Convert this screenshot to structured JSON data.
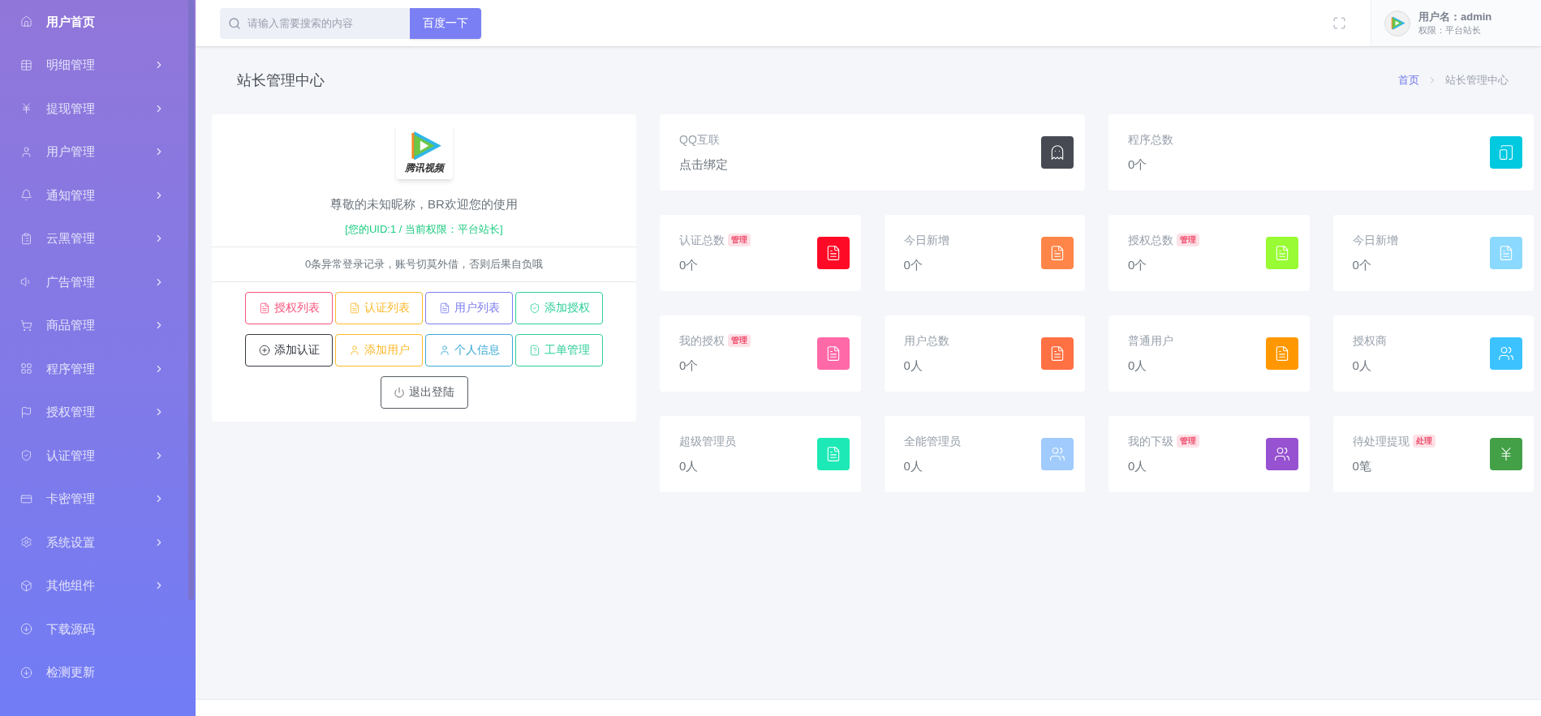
{
  "sidebar": {
    "items": [
      {
        "label": "用户首页",
        "expandable": false,
        "selected": true
      },
      {
        "label": "明细管理",
        "expandable": true,
        "selected": false
      },
      {
        "label": "提现管理",
        "expandable": true,
        "selected": false
      },
      {
        "label": "用户管理",
        "expandable": true,
        "selected": false
      },
      {
        "label": "通知管理",
        "expandable": true,
        "selected": false
      },
      {
        "label": "云黑管理",
        "expandable": true,
        "selected": false
      },
      {
        "label": "广告管理",
        "expandable": true,
        "selected": false
      },
      {
        "label": "商品管理",
        "expandable": true,
        "selected": false
      },
      {
        "label": "程序管理",
        "expandable": true,
        "selected": false
      },
      {
        "label": "授权管理",
        "expandable": true,
        "selected": false
      },
      {
        "label": "认证管理",
        "expandable": true,
        "selected": false
      },
      {
        "label": "卡密管理",
        "expandable": true,
        "selected": false
      },
      {
        "label": "系统设置",
        "expandable": true,
        "selected": false
      },
      {
        "label": "其他组件",
        "expandable": true,
        "selected": false
      },
      {
        "label": "下载源码",
        "expandable": false,
        "selected": false
      },
      {
        "label": "检测更新",
        "expandable": false,
        "selected": false
      }
    ]
  },
  "topbar": {
    "search": {
      "placeholder": "请输入需要搜索的内容"
    },
    "search_button": "百度一下",
    "user": {
      "name": "用户名：admin",
      "role": "权限：平台站长"
    }
  },
  "page": {
    "title": "站长管理中心",
    "breadcrumb": [
      "首页",
      "站长管理中心"
    ]
  },
  "profile": {
    "logo_text": "腾讯视频",
    "greeting": "尊敬的未知昵称，BR欢迎您的使用",
    "uid_line": "[您的UID:1 / 当前权限：平台站长]",
    "notice": "0条异常登录记录，账号切莫外借，否则后果自负哦",
    "buttons": [
      {
        "label": "授权列表",
        "color": "#f9547a"
      },
      {
        "label": "认证列表",
        "color": "#fcb92c"
      },
      {
        "label": "用户列表",
        "color": "#7c7cf0"
      },
      {
        "label": "添加授权",
        "color": "#2ecf98"
      },
      {
        "label": "添加认证",
        "color": "#343a40"
      },
      {
        "label": "添加用户",
        "color": "#fcb92c"
      },
      {
        "label": "个人信息",
        "color": "#3ba9d6"
      },
      {
        "label": "工单管理",
        "color": "#2ecf98"
      },
      {
        "label": "退出登陆",
        "color": "#555b61"
      }
    ]
  },
  "stats": [
    {
      "label": "QQ互联",
      "value": "点击绑定",
      "color": "#474a52"
    },
    {
      "label": "程序总数",
      "value": "0个",
      "color": "#00c9e0"
    },
    {
      "label": "认证总数",
      "badge": "管理",
      "value": "0个",
      "color": "#ff0a26"
    },
    {
      "label": "今日新增",
      "value": "0个",
      "color": "#ff8548"
    },
    {
      "label": "授权总数",
      "badge": "管理",
      "value": "0个",
      "color": "#98fb33"
    },
    {
      "label": "今日新增",
      "value": "0个",
      "color": "#8bd9fe"
    },
    {
      "label": "我的授权",
      "badge": "管理",
      "value": "0个",
      "color": "#ff69a8"
    },
    {
      "label": "用户总数",
      "value": "0人",
      "color": "#ff7043"
    },
    {
      "label": "普通用户",
      "value": "0人",
      "color": "#ff9800"
    },
    {
      "label": "授权商",
      "value": "0人",
      "color": "#3cc3ff"
    },
    {
      "label": "超级管理员",
      "value": "0人",
      "color": "#1de9b6"
    },
    {
      "label": "全能管理员",
      "value": "0人",
      "color": "#a0cbfc"
    },
    {
      "label": "我的下级",
      "badge": "管理",
      "value": "0人",
      "color": "#9652d0"
    },
    {
      "label": "待处理提现",
      "badge": "处理",
      "value": "0笔",
      "color": "#43a047"
    }
  ]
}
